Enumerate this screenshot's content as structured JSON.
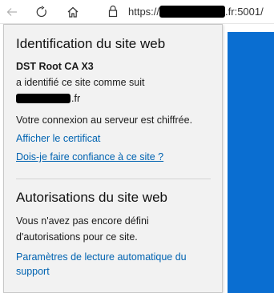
{
  "browser": {
    "address": {
      "scheme": "https://",
      "port_path": ".fr:5001/"
    },
    "icons": {
      "back": "arrow-left-icon",
      "refresh": "refresh-icon",
      "home": "home-icon",
      "lock": "lock-icon"
    }
  },
  "flyout": {
    "identity_title": "Identification du site web",
    "issuer": "DST Root CA X3",
    "identified_text": "a identifié ce site comme suit",
    "host_suffix": ".fr",
    "connection_text": "Votre connexion au serveur est chiffrée.",
    "view_certificate_link": "Afficher le certificat",
    "trust_link": "Dois-je faire confiance à ce site ?",
    "permissions_title": "Autorisations du site web",
    "permissions_text_line1": "Vous n'avez pas encore défini",
    "permissions_text_line2": "d'autorisations pour ce site.",
    "autoplay_link_line1": "Paramètres de lecture automatique du",
    "autoplay_link_line2": "support"
  },
  "colors": {
    "link": "#0063b1",
    "page_accent": "#0a6ed1",
    "flyout_background": "#f2f2f2"
  }
}
